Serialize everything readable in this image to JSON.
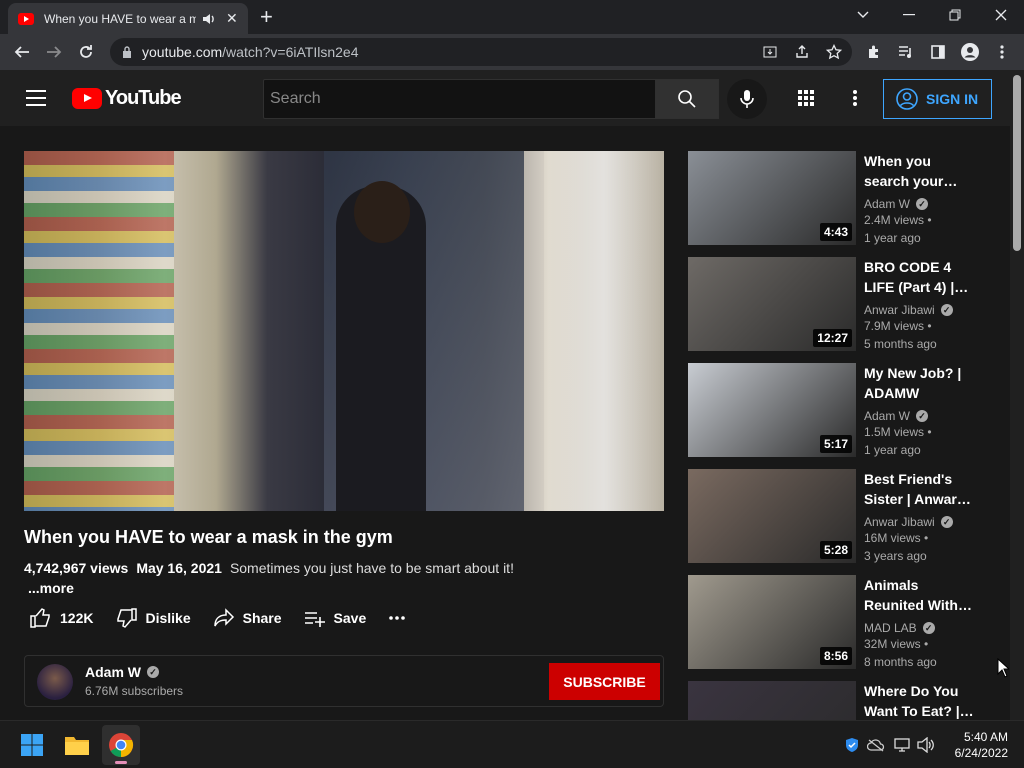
{
  "browser": {
    "tab_title": "When you HAVE to wear a mask in the gym - YouTube",
    "url_host": "youtube.com",
    "url_path": "/watch?v=6iATIlsn2e4"
  },
  "header": {
    "logo_text": "YouTube",
    "search_placeholder": "Search",
    "signin_label": "SIGN IN"
  },
  "video": {
    "title": "When you HAVE to wear a mask in the gym",
    "views": "4,742,967 views",
    "date": "May 16, 2021",
    "description": "Sometimes you just have to be smart about it!",
    "more_label": "...more",
    "likes": "122K",
    "dislike_label": "Dislike",
    "share_label": "Share",
    "save_label": "Save"
  },
  "channel": {
    "name": "Adam W",
    "subscribers": "6.76M subscribers",
    "subscribe_label": "SUBSCRIBE"
  },
  "recommendations": [
    {
      "title": "When you search your…",
      "channel": "Adam W",
      "views": "2.4M views •",
      "age": "1 year ago",
      "duration": "4:43",
      "thumb_color": "#8a8f96"
    },
    {
      "title": "BRO CODE 4 LIFE (Part 4) |…",
      "channel": "Anwar Jibawi",
      "views": "7.9M views •",
      "age": "5 months ago",
      "duration": "12:27",
      "thumb_color": "#6e6a66"
    },
    {
      "title": "My New Job? | ADAMW",
      "channel": "Adam W",
      "views": "1.5M views •",
      "age": "1 year ago",
      "duration": "5:17",
      "thumb_color": "#c8ccd2"
    },
    {
      "title": "Best Friend's Sister | Anwar…",
      "channel": "Anwar Jibawi",
      "views": "16M views •",
      "age": "3 years ago",
      "duration": "5:28",
      "thumb_color": "#7a6a60"
    },
    {
      "title": "Animals Reunited With…",
      "channel": "MAD LAB",
      "views": "32M views •",
      "age": "8 months ago",
      "duration": "8:56",
      "thumb_color": "#a09a8e"
    },
    {
      "title": "Where Do You Want To Eat? |…",
      "channel": "",
      "views": "",
      "age": "",
      "duration": "",
      "thumb_color": "#3a3440"
    }
  ],
  "taskbar": {
    "time": "5:40 AM",
    "date": "6/24/2022"
  }
}
